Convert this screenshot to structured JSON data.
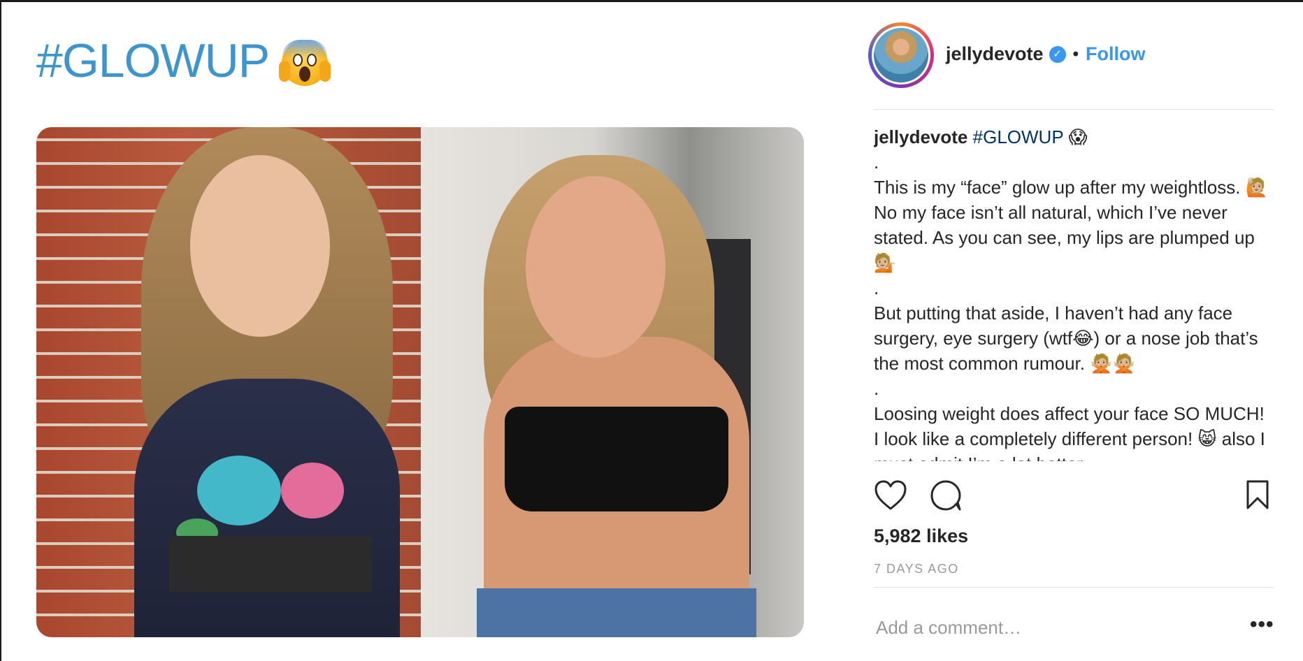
{
  "post": {
    "title": "#GLOWUP",
    "title_emoji": "😱",
    "image_alt": "before and after weight loss comparison photo"
  },
  "header": {
    "username": "jellydevote",
    "verified_icon": "verified-badge",
    "separator": "•",
    "follow_label": "Follow"
  },
  "caption": {
    "username": "jellydevote",
    "hashtag": "#GLOWUP",
    "hashtag_emoji": "😱",
    "lines": [
      ".",
      "This is my “face” glow up after my weightloss. 🙋🏼 No my face isn’t all natural, which I’ve never stated. As you can see, my lips are plumped up 💁🏼",
      ".",
      "But putting that aside, I haven’t had any face surgery, eye surgery (wtf😂) or a nose job that’s the most common rumour. 🙅🏼🙅🏼",
      ".",
      "Loosing weight does affect your face SO MUCH! I look like a completely different person! 😸 also I must admit I’m a lot better"
    ]
  },
  "actions": {
    "like_icon": "heart-icon",
    "comment_icon": "comment-bubble-icon",
    "save_icon": "bookmark-icon"
  },
  "likes_text": "5,982 likes",
  "time_ago": "7 DAYS AGO",
  "comment": {
    "placeholder": "Add a comment…",
    "more_label": "•••"
  },
  "colors": {
    "title_blue": "#3d95cf",
    "link_blue": "#3897f0",
    "hashtag_navy": "#003569",
    "text": "#262626",
    "muted": "#999999"
  }
}
